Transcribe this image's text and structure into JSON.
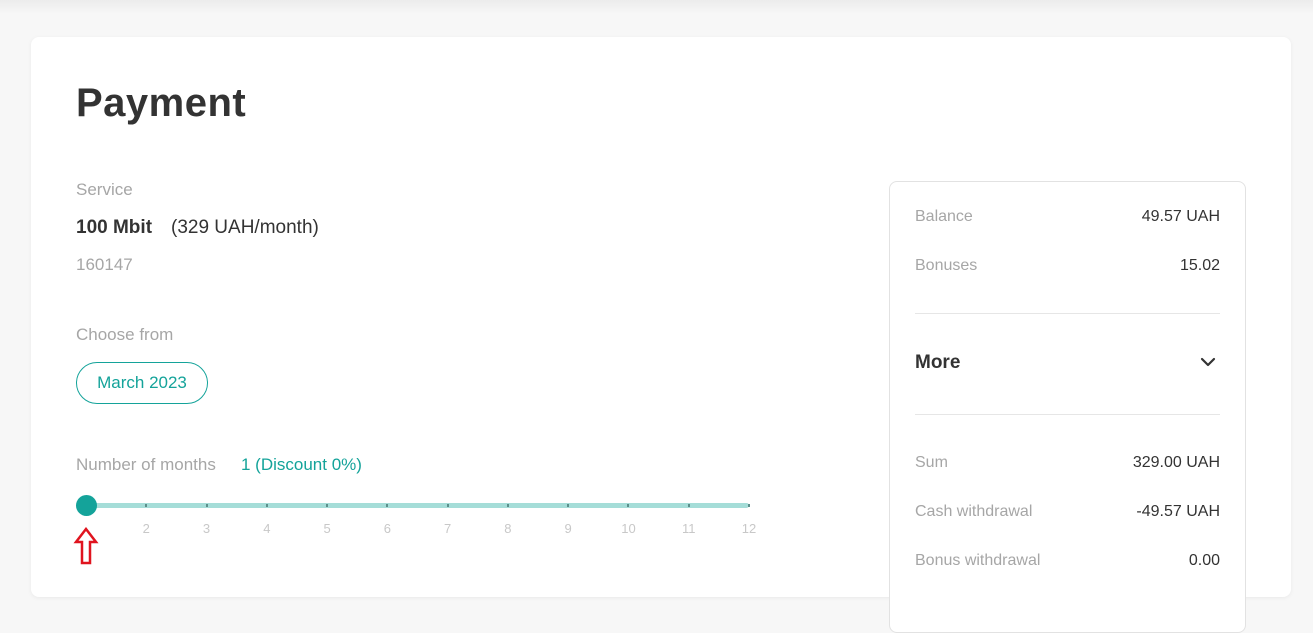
{
  "page": {
    "title": "Payment"
  },
  "service": {
    "label": "Service",
    "name": "100 Mbit",
    "price": "(329 UAH/month)",
    "account_id": "160147"
  },
  "choose_from": {
    "label": "Choose from",
    "month": "March 2023"
  },
  "months": {
    "label": "Number of months",
    "value": "1 (Discount 0%)",
    "slider": {
      "min": 1,
      "max": 12,
      "current": 1,
      "tick_labels": [
        "2",
        "3",
        "4",
        "5",
        "6",
        "7",
        "8",
        "9",
        "10",
        "11",
        "12"
      ]
    }
  },
  "summary": {
    "balance_label": "Balance",
    "balance_value": "49.57 UAH",
    "bonuses_label": "Bonuses",
    "bonuses_value": "15.02",
    "more_label": "More",
    "sum_label": "Sum",
    "sum_value": "329.00 UAH",
    "cash_label": "Cash withdrawal",
    "cash_value": "-49.57 UAH",
    "bonus_withdrawal_label": "Bonus withdrawal",
    "bonus_withdrawal_value": "0.00"
  },
  "colors": {
    "accent": "#14a39a",
    "track": "#a5ddd8",
    "annotation": "#e0141f"
  },
  "icons": {
    "more": "chevron-down-icon",
    "annotation": "arrow-up-outline-icon"
  }
}
